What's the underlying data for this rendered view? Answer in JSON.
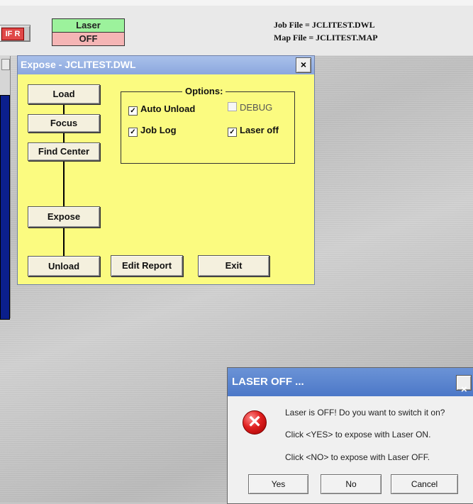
{
  "toolbar": {
    "ifr_label": "IF R",
    "laser_label": "Laser",
    "laser_state": "OFF",
    "job_file": "Job File = JCLITEST.DWL",
    "map_file": "Map File = JCLITEST.MAP"
  },
  "expose_window": {
    "title": "Expose - JCLITEST.DWL",
    "close_label": "×",
    "steps": [
      "Load",
      "Focus",
      "Find Center",
      "Expose",
      "Unload"
    ],
    "edit_report_label": "Edit Report",
    "exit_label": "Exit",
    "options": {
      "legend": "Options:",
      "auto_unload": {
        "label": "Auto Unload",
        "checked": true
      },
      "debug": {
        "label": "DEBUG",
        "checked": false
      },
      "job_log": {
        "label": "Job Log",
        "checked": true
      },
      "laser_off": {
        "label": "Laser off",
        "checked": true
      }
    }
  },
  "laser_dialog": {
    "title": "LASER OFF ...",
    "close_label": "×",
    "messages": [
      "Laser is OFF! Do you want to switch it on?",
      "Click <YES> to expose with Laser ON.",
      "Click <NO> to expose with Laser OFF."
    ],
    "buttons": {
      "yes": "Yes",
      "no": "No",
      "cancel": "Cancel"
    }
  },
  "colors": {
    "laser_on_bg": "#9cf29c",
    "laser_off_bg": "#f5b5b5",
    "expose_bg": "#fbfb80",
    "title_blue": "#8ba7de",
    "error_red": "#e02020"
  },
  "icons": {
    "dialog_icon": "error-icon",
    "checkbox_mark": "checkmark-icon"
  }
}
